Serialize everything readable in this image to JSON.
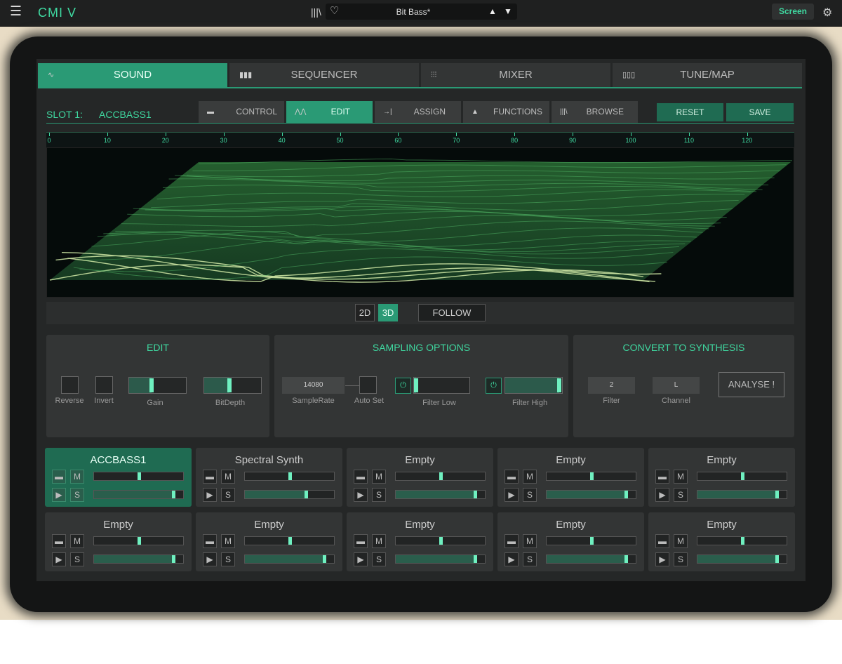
{
  "topbar": {
    "menu_icon": "hamburger-icon",
    "app_name": "CMI V",
    "library_icon": "library-icon",
    "favorite_icon": "heart-icon",
    "preset_name": "Bit Bass*",
    "prev_icon": "▲",
    "next_icon": "▼",
    "screen_label": "Screen",
    "settings_icon": "gear-icon"
  },
  "main_tabs": [
    {
      "label": "SOUND",
      "icon": "waveform-icon",
      "active": true
    },
    {
      "label": "SEQUENCER",
      "icon": "bars-icon",
      "active": false
    },
    {
      "label": "MIXER",
      "icon": "faders-icon",
      "active": false
    },
    {
      "label": "TUNE/MAP",
      "icon": "keys-icon",
      "active": false
    }
  ],
  "slot": {
    "label": "SLOT 1:",
    "name": "ACCBASS1"
  },
  "sub_tabs": [
    {
      "label": "CONTROL",
      "icon": "control-icon",
      "active": false
    },
    {
      "label": "EDIT",
      "icon": "edit-wave-icon",
      "active": true
    },
    {
      "label": "ASSIGN",
      "icon": "assign-icon",
      "active": false
    },
    {
      "label": "FUNCTIONS",
      "icon": "functions-icon",
      "active": false
    },
    {
      "label": "BROWSE",
      "icon": "browse-icon",
      "active": false
    }
  ],
  "actions": {
    "reset": "RESET",
    "save": "SAVE"
  },
  "ruler_ticks": [
    "0",
    "10",
    "20",
    "30",
    "40",
    "50",
    "60",
    "70",
    "80",
    "90",
    "100",
    "110",
    "120"
  ],
  "view_modes": {
    "mode_2d": "2D",
    "mode_3d": "3D",
    "follow": "FOLLOW",
    "active": "3D"
  },
  "edit_panel": {
    "title": "EDIT",
    "reverse": "Reverse",
    "invert": "Invert",
    "gain": "Gain",
    "gain_value": 0.4,
    "bitdepth": "BitDepth",
    "bitdepth_value": 0.45
  },
  "sampling_panel": {
    "title": "SAMPLING OPTIONS",
    "samplerate_value": "14080",
    "samplerate_label": "SampleRate",
    "autoset_label": "Auto Set",
    "filter_low_label": "Filter Low",
    "filter_low_value": 0.02,
    "filter_high_label": "Filter High",
    "filter_high_value": 0.98
  },
  "synthesis_panel": {
    "title": "CONVERT TO SYNTHESIS",
    "filter_value": "2",
    "filter_label": "Filter",
    "channel_value": "L",
    "channel_label": "Channel",
    "analyse": "ANALYSE !"
  },
  "voices": [
    {
      "name": "ACCBASS1",
      "selected": true,
      "pitch": 0.5,
      "level": 0.9
    },
    {
      "name": "Spectral Synth",
      "selected": false,
      "pitch": 0.5,
      "level": 0.69
    },
    {
      "name": "Empty",
      "selected": false,
      "pitch": 0.5,
      "level": 0.9
    },
    {
      "name": "Empty",
      "selected": false,
      "pitch": 0.5,
      "level": 0.9
    },
    {
      "name": "Empty",
      "selected": false,
      "pitch": 0.5,
      "level": 0.9
    },
    {
      "name": "Empty",
      "selected": false,
      "pitch": 0.5,
      "level": 0.9
    },
    {
      "name": "Empty",
      "selected": false,
      "pitch": 0.5,
      "level": 0.9
    },
    {
      "name": "Empty",
      "selected": false,
      "pitch": 0.5,
      "level": 0.9
    },
    {
      "name": "Empty",
      "selected": false,
      "pitch": 0.5,
      "level": 0.9
    },
    {
      "name": "Empty",
      "selected": false,
      "pitch": 0.5,
      "level": 0.9
    }
  ],
  "voice_buttons": {
    "folder_icon": "folder-icon",
    "mute": "M",
    "play_icon": "play-icon",
    "solo": "S"
  }
}
